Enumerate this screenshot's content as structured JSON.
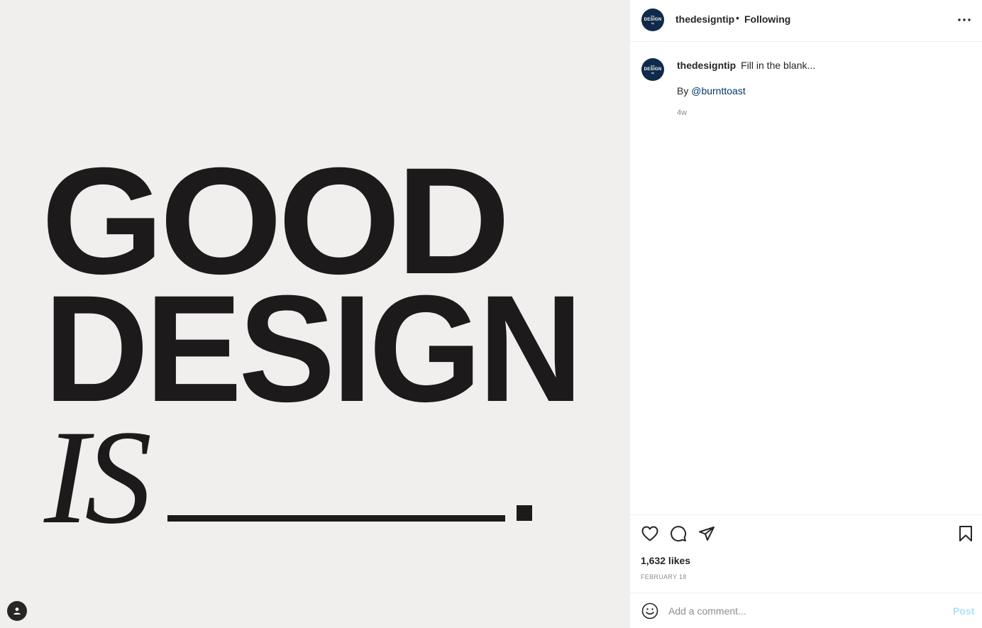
{
  "media": {
    "line1": "GOOD",
    "line2": "DESIGN",
    "line3": "IS",
    "background": "#f1efed",
    "ink": "#1c1a1a"
  },
  "header": {
    "avatar_top": "the",
    "avatar_main": "DESIGN",
    "avatar_bottom": "tip",
    "username": "thedesigntip",
    "separator": "•",
    "follow_status": "Following",
    "more_icon": "more-horizontal-icon"
  },
  "caption": {
    "username": "thedesigntip",
    "text": "Fill in the blank...",
    "credit_prefix": "By",
    "credit_handle": "@burnttoast",
    "time_ago": "4w"
  },
  "actions": {
    "icons": [
      "heart-icon",
      "comment-icon",
      "share-icon",
      "bookmark-icon"
    ],
    "likes": "1,632 likes",
    "date": "FEBRUARY 18"
  },
  "comment": {
    "placeholder": "Add a comment...",
    "post_label": "Post",
    "post_color": "#b2dffc"
  }
}
